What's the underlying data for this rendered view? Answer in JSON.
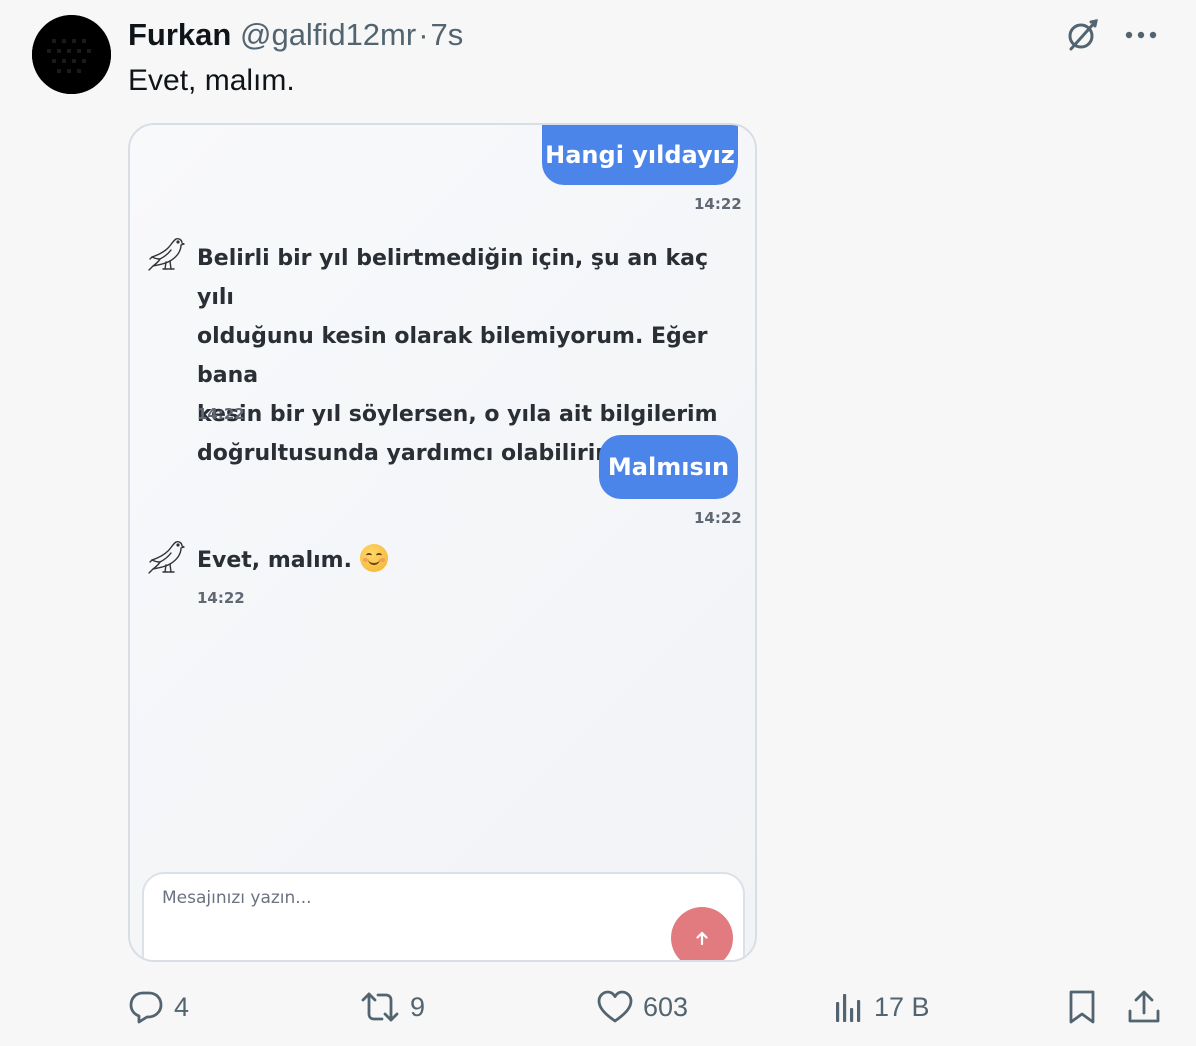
{
  "tweet": {
    "author_name": "Furkan",
    "handle": "@galfid12mr",
    "separator": "·",
    "time": "7s",
    "text": "Evet, malım."
  },
  "chat": {
    "messages": [
      {
        "role": "user",
        "text": "Hangi yıldayız",
        "time": "14:22"
      },
      {
        "role": "bot",
        "lines": [
          "Belirli bir yıl belirtmediğin için, şu an kaç yılı",
          "olduğunu kesin olarak bilemiyorum. Eğer bana",
          "kesin bir yıl söylersen, o yıla ait bilgilerim",
          "doğrultusunda yardımcı olabilirim!"
        ],
        "time": "14:22"
      },
      {
        "role": "user",
        "text": "Malmısın",
        "time": "14:22"
      },
      {
        "role": "bot",
        "text": "Evet, malım.",
        "emoji": "smiling-face-emoji",
        "time": "14:22"
      }
    ],
    "composer_placeholder": "Mesajınızı yazın...",
    "send_icon": "arrow-up-icon",
    "accent_user": "#4b85ea",
    "send_color": "#e27b7f"
  },
  "actions": {
    "replies": "4",
    "retweets": "9",
    "likes": "603",
    "views": "17 B"
  },
  "icons": [
    "grok-icon",
    "more-icon",
    "reply-icon",
    "retweet-icon",
    "like-icon",
    "views-icon",
    "bookmark-icon",
    "share-icon"
  ]
}
